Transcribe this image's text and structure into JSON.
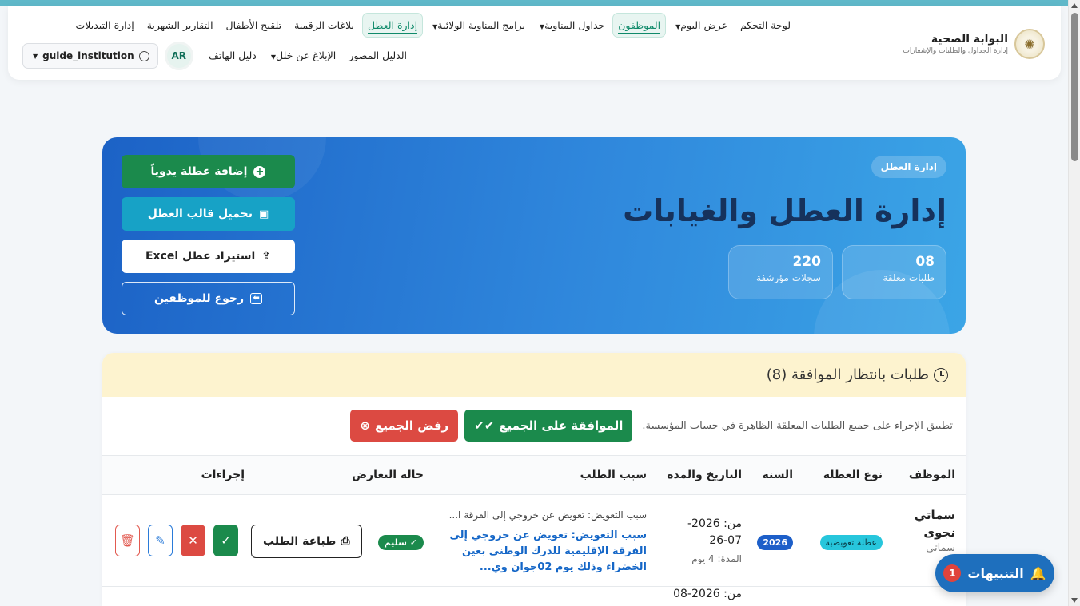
{
  "brand": {
    "title": "البوابة الصحية",
    "subtitle": "إدارة الجداول والطلبات والإشعارات"
  },
  "nav": {
    "row1": [
      {
        "label": "لوحة التحكم",
        "dropdown": false,
        "active": false
      },
      {
        "label": "عرض اليوم",
        "dropdown": true,
        "active": false
      },
      {
        "label": "الموظفون",
        "dropdown": false,
        "active": true
      },
      {
        "label": "جداول المناوبة",
        "dropdown": true,
        "active": false
      },
      {
        "label": "برامج المناوبة الولائية",
        "dropdown": true,
        "active": false
      },
      {
        "label": "إدارة العطل",
        "dropdown": false,
        "active": true
      },
      {
        "label": "بلاغات الرقمنة",
        "dropdown": false,
        "active": false
      },
      {
        "label": "تلقيح الأطفال",
        "dropdown": false,
        "active": false
      },
      {
        "label": "التقارير الشهرية",
        "dropdown": false,
        "active": false
      },
      {
        "label": "إدارة التبديلات",
        "dropdown": false,
        "active": false
      }
    ],
    "row2": [
      {
        "label": "الدليل المصور",
        "dropdown": false
      },
      {
        "label": "الإبلاغ عن خلل",
        "dropdown": true
      },
      {
        "label": "دليل الهاتف",
        "dropdown": false
      }
    ],
    "lang": "AR",
    "user": "guide_institution"
  },
  "hero": {
    "badge": "إدارة العطل",
    "title": "إدارة العطل والغيابات",
    "stats": [
      {
        "value": "08",
        "label": "طلبات معلقة"
      },
      {
        "value": "220",
        "label": "سجلات مؤرشفة"
      }
    ],
    "buttons": {
      "add_manual": "إضافة عطلة يدوياً",
      "download_template": "تحميل قالب العطل",
      "import_excel": "استيراد عطل Excel",
      "back_employees": "رجوع للموظفين"
    }
  },
  "pending": {
    "title": "طلبات بانتظار الموافقة (8)",
    "bulk_text": "تطبيق الإجراء على جميع الطلبات المعلقة الظاهرة في حساب المؤسسة.",
    "approve_all": "الموافقة على الجميع",
    "reject_all": "رفض الجميع",
    "columns": [
      "الموظف",
      "نوع العطلة",
      "السنة",
      "التاريخ والمدة",
      "سبب الطلب",
      "حالة التعارض",
      "إجراءات"
    ],
    "rows": [
      {
        "employee": "سماتي نجوى",
        "employee_sub": "سماتي",
        "type": "عطلة تعويضية",
        "year": "2026",
        "from": "من: 2026-07-26",
        "duration": "المدة: 4 يوم",
        "reason_short": "سبب التعويض: تعويض عن خروجي إلى الفرقة ا...",
        "reason_full": "سبب التعويض: تعويض عن خروجي إلى الفرقة الإقليمية للدرك الوطني بعين الخضراء وذلك يوم 02جوان وي...",
        "conflict": "سليم",
        "print_label": "طباعة الطلب"
      }
    ],
    "next_row_from": "من: 2026-08"
  },
  "notifications": {
    "label": "التنبيهات",
    "count": "1"
  }
}
